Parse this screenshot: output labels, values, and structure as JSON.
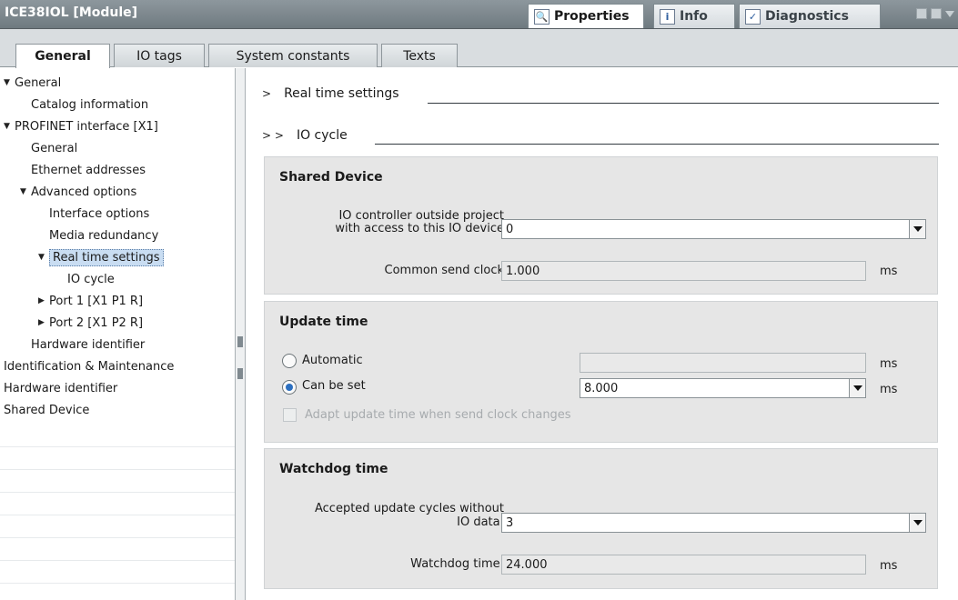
{
  "window": {
    "title": "ICE38IOL [Module]",
    "panel_tabs": [
      {
        "label": "Properties",
        "icon": "properties-icon",
        "active": true
      },
      {
        "label": "Info",
        "icon": "info-icon",
        "active": false
      },
      {
        "label": "Diagnostics",
        "icon": "diagnostics-icon",
        "active": false
      }
    ]
  },
  "tabs": [
    {
      "label": "General",
      "active": true
    },
    {
      "label": "IO tags",
      "active": false
    },
    {
      "label": "System constants",
      "active": false
    },
    {
      "label": "Texts",
      "active": false
    }
  ],
  "nav": [
    {
      "label": "General",
      "level": 0,
      "toggle": "▼"
    },
    {
      "label": "Catalog information",
      "level": 2,
      "toggle": ""
    },
    {
      "label": "PROFINET interface [X1]",
      "level": 0,
      "toggle": "▼"
    },
    {
      "label": "General",
      "level": 2,
      "toggle": ""
    },
    {
      "label": "Ethernet addresses",
      "level": 2,
      "toggle": ""
    },
    {
      "label": "Advanced options",
      "level": 1,
      "toggle": "▼"
    },
    {
      "label": "Interface options",
      "level": 3,
      "toggle": ""
    },
    {
      "label": "Media redundancy",
      "level": 3,
      "toggle": ""
    },
    {
      "label": "Real time settings",
      "level": 2,
      "toggle": "▼",
      "selected": true
    },
    {
      "label": "IO cycle",
      "level": 4,
      "toggle": ""
    },
    {
      "label": "Port 1 [X1 P1 R]",
      "level": 2,
      "toggle": "▶"
    },
    {
      "label": "Port 2 [X1 P2 R]",
      "level": 2,
      "toggle": "▶"
    },
    {
      "label": "Hardware identifier",
      "level": 2,
      "toggle": ""
    },
    {
      "label": "Identification & Maintenance",
      "level": 0,
      "toggle": ""
    },
    {
      "label": "Hardware identifier",
      "level": 0,
      "toggle": ""
    },
    {
      "label": "Shared Device",
      "level": 0,
      "toggle": ""
    }
  ],
  "content": {
    "section1": {
      "chevron": ">",
      "title": "Real time settings"
    },
    "section2": {
      "chevron": "> >",
      "title": "IO cycle"
    },
    "shared_device": {
      "title": "Shared Device",
      "controller_label_1": "IO controller outside project",
      "controller_label_2": "with access to this IO device",
      "controller_value": "0",
      "send_clock_label": "Common send clock",
      "send_clock_value": "1.000",
      "send_clock_unit": "ms"
    },
    "update_time": {
      "title": "Update time",
      "automatic_label": "Automatic",
      "automatic_value": "",
      "automatic_unit": "ms",
      "automatic_selected": false,
      "can_be_set_label": "Can be set",
      "can_be_set_value": "8.000",
      "can_be_set_unit": "ms",
      "can_be_set_selected": true,
      "adapt_label": "Adapt update time when send clock changes",
      "adapt_checked": false
    },
    "watchdog": {
      "title": "Watchdog time",
      "cycles_label_1": "Accepted update cycles without",
      "cycles_label_2": "IO data:",
      "cycles_value": "3",
      "time_label": "Watchdog time:",
      "time_value": "24.000",
      "time_unit": "ms"
    }
  },
  "colors": {
    "titlebar": "#7f8a90",
    "selection": "#c9ddf2",
    "group_bg": "#e6e6e6",
    "radio_on": "#2c6fc0"
  }
}
